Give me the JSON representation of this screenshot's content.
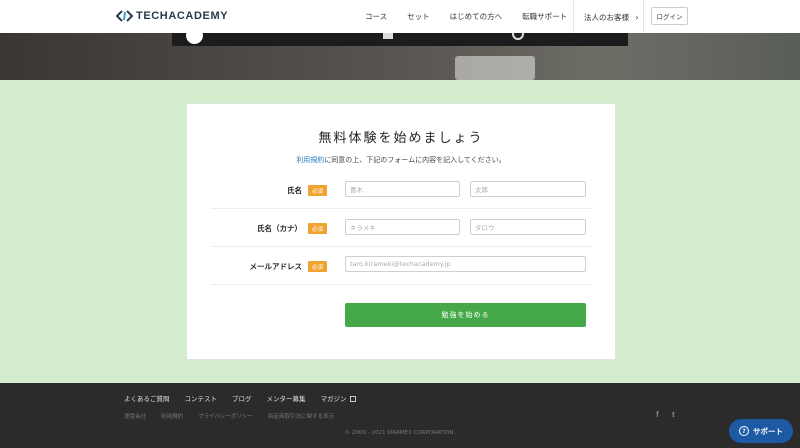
{
  "header": {
    "logo_text": "TECHACADEMY",
    "nav": [
      "コース",
      "セット",
      "はじめての方へ",
      "転職サポート"
    ],
    "corporate": "法人のお客様",
    "login": "ログイン"
  },
  "form": {
    "title": "無料体験を始めましょう",
    "subtitle_link": "利用規約",
    "subtitle_rest": "に同意の上、下記のフォームに内容を記入してください。",
    "required_label": "必須",
    "name_label": "氏名",
    "last_name_placeholder": "喜木",
    "first_name_placeholder": "太郎",
    "kana_label": "氏名（カナ）",
    "last_kana_placeholder": "キラメキ",
    "first_kana_placeholder": "タロウ",
    "email_label": "メールアドレス",
    "email_placeholder": "taro.kirameki@techacademy.jp",
    "submit": "勉強を始める"
  },
  "footer": {
    "links": [
      "よくあるご質問",
      "コンテスト",
      "ブログ",
      "メンター募集",
      "マガジン"
    ],
    "sub_links": [
      "運営会社",
      "利用規約",
      "プライバシーポリシー",
      "特定商取引法に関する表示"
    ],
    "facebook": "f",
    "twitter": "t",
    "copyright": "© 2009 - 2021 KIRAMEX CORPORATION."
  },
  "support": {
    "label": "サポート"
  },
  "icons": [
    "logo-chevron-icon",
    "chevron-right-icon",
    "external-link-icon",
    "facebook-icon",
    "twitter-icon",
    "question-icon"
  ]
}
